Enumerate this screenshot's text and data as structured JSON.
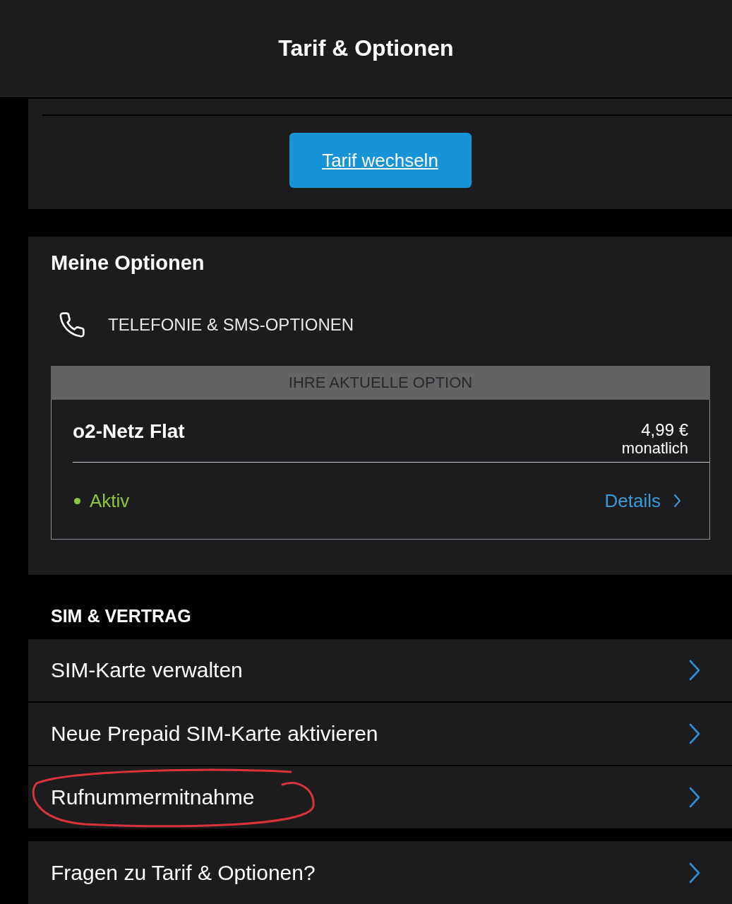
{
  "header": {
    "title": "Tarif & Optionen"
  },
  "tariff_card": {
    "button": "Tarif wechseln"
  },
  "options_card": {
    "title": "Meine Optionen",
    "category": "TELEFONIE & SMS-OPTIONEN",
    "current_option": {
      "banner": "IHRE AKTUELLE OPTION",
      "name": "o2-Netz Flat",
      "price": "4,99 €",
      "period": "monatlich",
      "status": {
        "label": "Aktiv",
        "active": true
      },
      "details_link": "Details"
    }
  },
  "sim_section": {
    "title": "SIM & VERTRAG",
    "items": [
      {
        "label": "SIM-Karte verwalten",
        "circled": false
      },
      {
        "label": "Neue Prepaid SIM-Karte aktivieren",
        "circled": false
      },
      {
        "label": "Rufnummermitnahme",
        "circled": true
      }
    ]
  },
  "help_link": {
    "label": "Fragen zu Tarif & Optionen?"
  }
}
